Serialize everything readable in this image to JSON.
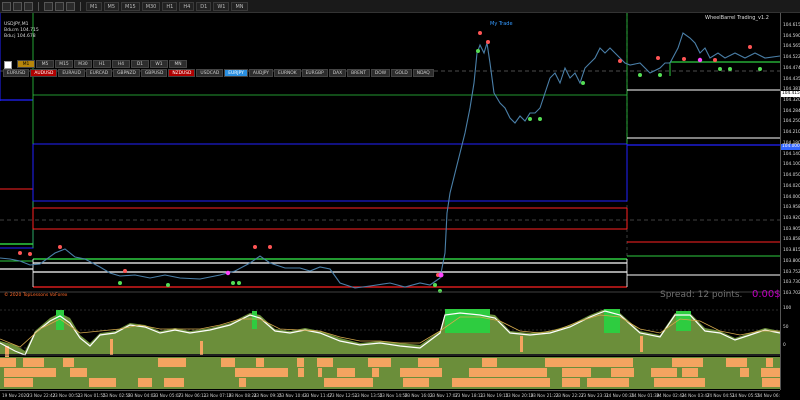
{
  "toolbar": {
    "timeframes": [
      "M1",
      "M5",
      "M15",
      "M30",
      "H1",
      "H4",
      "D1",
      "W1",
      "MN"
    ]
  },
  "symbol_info": {
    "title": "USDJPY,M1",
    "bid_line": "Bdu:m 104.715",
    "ask_line": "Bdu:j 104.678"
  },
  "panel": {
    "timeframes": [
      "M1",
      "M5",
      "M15",
      "M30",
      "H1",
      "H4",
      "D1",
      "W1",
      "MN"
    ],
    "active_timeframe": 0,
    "symbols": [
      "EURUSD",
      "AUDUSD",
      "EURAUD",
      "EURCAD",
      "GBPNZD",
      "GBPUSD",
      "NZDUSD",
      "USDCAD",
      "EURJPY",
      "AUDJPY",
      "EURNOK",
      "EURGBP",
      "DAX",
      "BRENT",
      "DOW",
      "GOLD",
      "NDAQ"
    ],
    "red_symbols": [
      1,
      6
    ],
    "selected_symbol": 8
  },
  "labels": {
    "top_label": "My Trade",
    "ea_label": "WheelBarrel Trading_v1.2",
    "copyright": "© 2020 TopLessons VoForex",
    "spread": "Spread: 12 points.",
    "profit": "0.00$"
  },
  "price_axis": {
    "labels": [
      "104.615",
      "104.590",
      "104.565",
      "104.522",
      "104.474",
      "104.435",
      "104.381",
      "104.320",
      "104.284",
      "104.250",
      "104.210",
      "104.180",
      "104.140",
      "104.100",
      "104.050",
      "104.020",
      "104.000",
      "103.958",
      "103.920",
      "103.905",
      "103.858",
      "103.815",
      "103.800",
      "103.752",
      "103.730",
      "103.702"
    ],
    "tags": [
      {
        "text": "104.415",
        "color": "#ffffff"
      },
      {
        "text": "104.000",
        "color": "#3366ff"
      }
    ],
    "indicator_labels": [
      "100",
      "50",
      "0"
    ]
  },
  "time_axis": {
    "labels": [
      "19 Nov 2020",
      "23 Nov 22:42",
      "23 Nov 00:51",
      "23 Nov 01:55",
      "23 Nov 02:59",
      "23 Nov 04:03",
      "23 Nov 05:07",
      "23 Nov 06:11",
      "23 Nov 07:19",
      "23 Nov 08:24",
      "23 Nov 09:35",
      "23 Nov 10:43",
      "23 Nov 11:47",
      "23 Nov 12:51",
      "23 Nov 13:55",
      "23 Nov 14:59",
      "23 Nov 16:03",
      "23 Nov 17:07",
      "23 Nov 18:11",
      "23 Nov 19:15",
      "23 Nov 20:19",
      "23 Nov 21:23",
      "23 Nov 22:27",
      "23 Nov 23:31",
      "24 Nov 00:35",
      "24 Nov 01:39",
      "24 Nov 02:43",
      "24 Nov 03:47",
      "24 Nov 04:51",
      "24 Nov 05:55",
      "24 Nov 06:00"
    ]
  },
  "colors": {
    "bg": "#000000",
    "green": "#2ecc40",
    "blue": "#2222ff",
    "red": "#ff2222",
    "white": "#ffffff",
    "price": "#4a7fa8",
    "osc_fill": "#6b8e3a",
    "bar_orange": "#f4a460"
  }
}
